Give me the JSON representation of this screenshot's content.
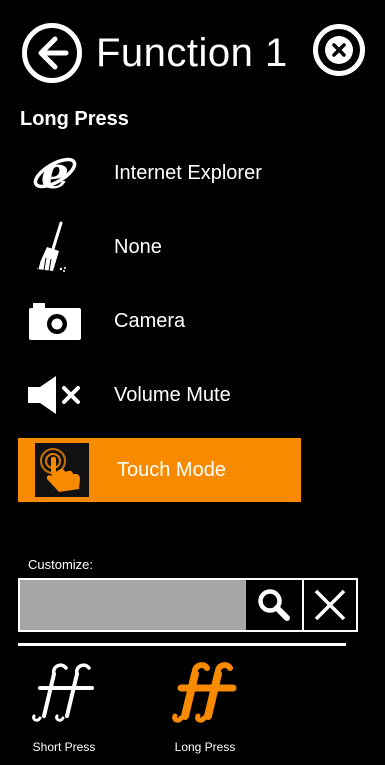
{
  "header": {
    "title": "Function 1",
    "back_icon": "arrow-left-circle-icon",
    "close_icon": "close-circle-icon"
  },
  "section": {
    "label": "Long Press"
  },
  "options": [
    {
      "label": "Internet Explorer",
      "icon": "internet-explorer-icon",
      "selected": false
    },
    {
      "label": "None",
      "icon": "broom-icon",
      "selected": false
    },
    {
      "label": "Camera",
      "icon": "camera-icon",
      "selected": false
    },
    {
      "label": "Volume Mute",
      "icon": "volume-mute-icon",
      "selected": false
    },
    {
      "label": "Touch Mode",
      "icon": "touch-hand-icon",
      "selected": true
    }
  ],
  "customize": {
    "label": "Customize:",
    "value": "",
    "placeholder": "",
    "search_icon": "search-icon",
    "clear_icon": "clear-x-icon"
  },
  "tabs": [
    {
      "label": "Short Press",
      "icon": "ff-short-press-icon",
      "active": false
    },
    {
      "label": "Long Press",
      "icon": "ff-long-press-icon",
      "active": true
    }
  ],
  "colors": {
    "accent": "#f88a00",
    "background": "#000000",
    "input_bg": "#a6a6a6",
    "text": "#ffffff"
  }
}
